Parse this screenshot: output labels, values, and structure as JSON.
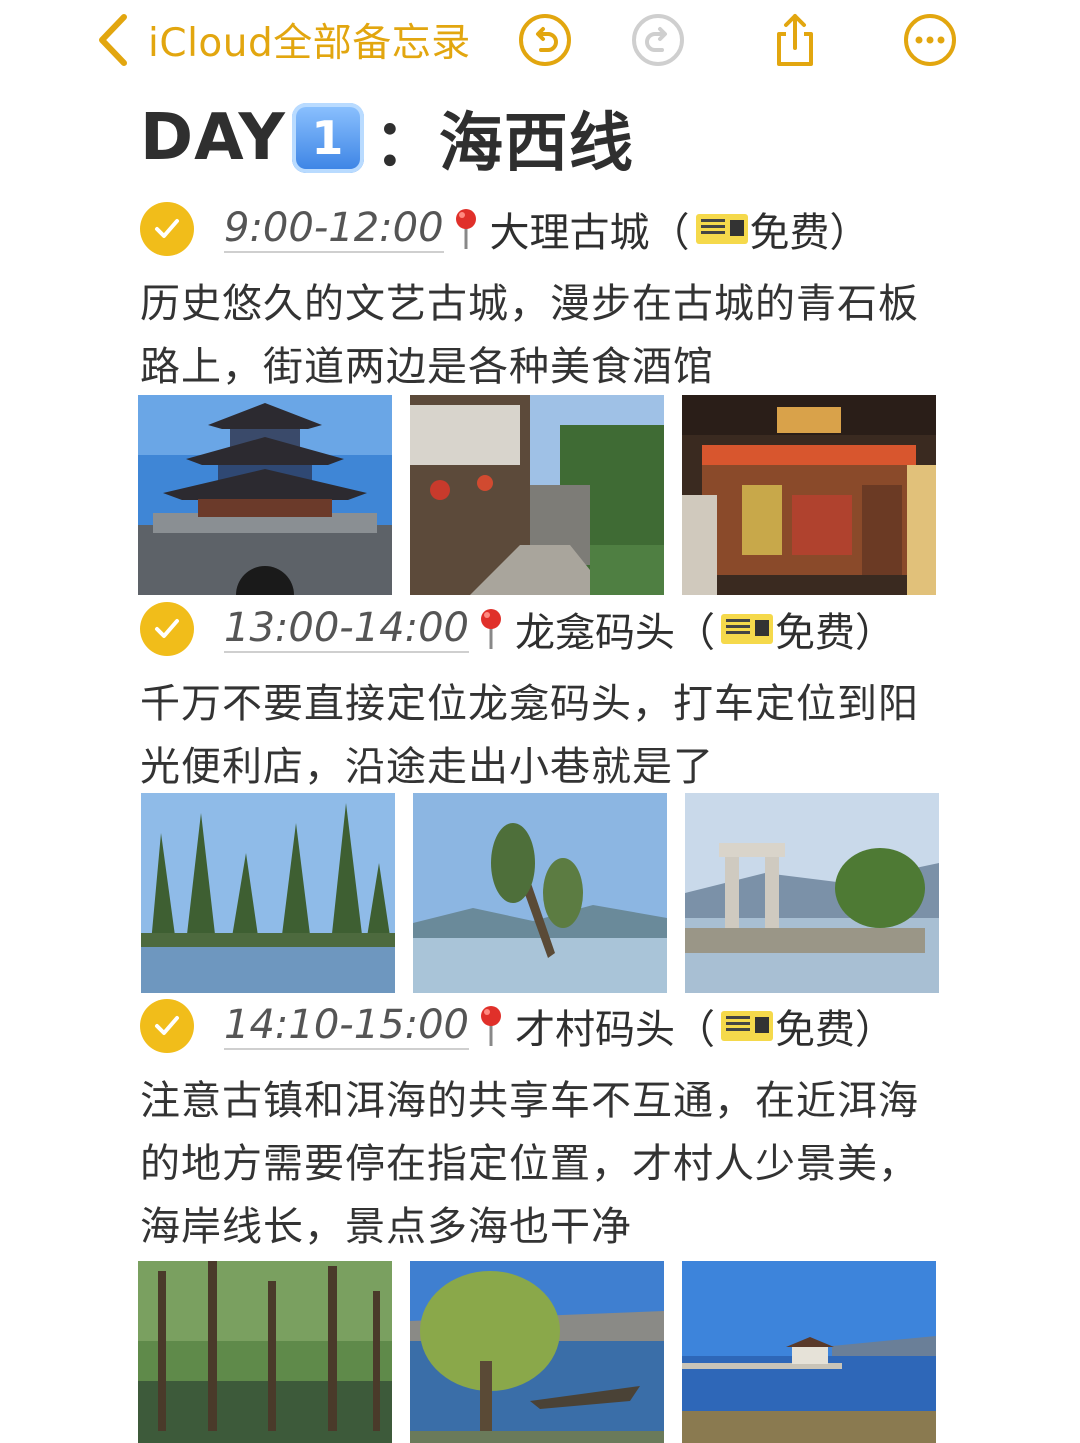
{
  "nav": {
    "back_label": "iCloud全部备忘录"
  },
  "note": {
    "title_prefix": "DAY",
    "title_number": "1",
    "title_suffix": "：海西线",
    "items": [
      {
        "time": "9:00-12:00",
        "place": "大理古城（",
        "fee": "免费）",
        "description": "历史悠久的文艺古城，漫步在古城的青石板路上，街道两边是各种美食酒馆"
      },
      {
        "time": "13:00-14:00",
        "place": "龙龛码头（",
        "fee": "免费）",
        "description": "千万不要直接定位龙龛码头，打车定位到阳光便利店，沿途走出小巷就是了"
      },
      {
        "time": "14:10-15:00",
        "place": "才村码头（",
        "fee": "免费）",
        "description": "注意古镇和洱海的共享车不互通，在近洱海的地方需要停在指定位置，才村人少景美，海岸线长，景点多海也干净"
      }
    ]
  },
  "colors": {
    "accent": "#e2a60f",
    "check": "#f1bd1a",
    "disabled": "#cfcfcf"
  },
  "icons": {
    "back": "chevron-left-icon",
    "undo": "undo-icon",
    "redo": "redo-icon",
    "share": "share-icon",
    "more": "more-icon",
    "check": "checkmark-icon",
    "pin": "round-pushpin-icon",
    "ticket": "ticket-icon"
  }
}
